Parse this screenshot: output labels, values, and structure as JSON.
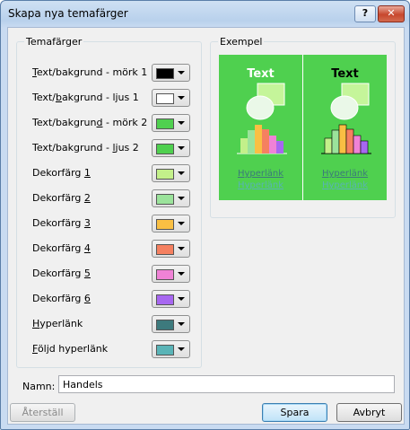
{
  "window": {
    "title": "Skapa nya temafärger",
    "help_label": "?",
    "close_label": "✕"
  },
  "theme_group": {
    "legend": "Temafärger",
    "rows": [
      {
        "pre": "",
        "u": "T",
        "post": "ext/bakgrund - mörk 1",
        "color": "#000000"
      },
      {
        "pre": "Text/",
        "u": "b",
        "post": "akgrund - ljus 1",
        "color": "#ffffff"
      },
      {
        "pre": "Text/bakgrun",
        "u": "d",
        "post": " - mörk 2",
        "color": "#4fd04f"
      },
      {
        "pre": "Text/bakgrund - ",
        "u": "l",
        "post": "jus 2",
        "color": "#4fd04f"
      },
      {
        "pre": "Dekorfärg ",
        "u": "1",
        "post": "",
        "color": "#c3f08a"
      },
      {
        "pre": "Dekorfärg ",
        "u": "2",
        "post": "",
        "color": "#9be39b"
      },
      {
        "pre": "Dekorfärg ",
        "u": "3",
        "post": "",
        "color": "#f9bf43"
      },
      {
        "pre": "Dekorfärg ",
        "u": "4",
        "post": "",
        "color": "#f58060"
      },
      {
        "pre": "Dekorfärg ",
        "u": "5",
        "post": "",
        "color": "#ef82d6"
      },
      {
        "pre": "Dekorfärg ",
        "u": "6",
        "post": "",
        "color": "#a767f0"
      },
      {
        "pre": "",
        "u": "H",
        "post": "yperlänk",
        "color": "#3d7a7d"
      },
      {
        "pre": "",
        "u": "F",
        "post": "öljd hyperlänk",
        "color": "#5ab4b7"
      }
    ]
  },
  "example_group": {
    "legend": "Exempel",
    "light_panel": {
      "text": "Text",
      "link": "Hyperlänk",
      "followed_link": "Hyperlänk",
      "text_color": "#ffffff"
    },
    "dark_panel": {
      "text": "Text",
      "link": "Hyperlänk",
      "followed_link": "Hyperlänk",
      "text_color": "#000000"
    },
    "background_color": "#4fd04f"
  },
  "name_field": {
    "label": "Namn:",
    "value": "Handels"
  },
  "buttons": {
    "reset": "Återställ",
    "save": "Spara",
    "cancel": "Avbryt"
  }
}
